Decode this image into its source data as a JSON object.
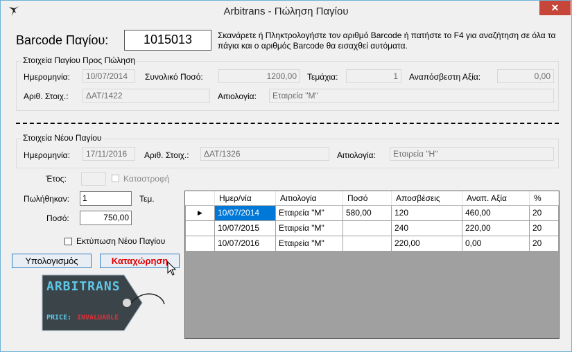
{
  "window": {
    "title": "Arbitrans - Πώληση Παγίου",
    "close_glyph": "✕"
  },
  "barcode": {
    "label": "Barcode Παγίου:",
    "value": "1015013",
    "hint": "Σκανάρετε ή Πληκτρολογήστε τον αριθμό Barcode ή πατήστε το F4 για αναζήτηση σε όλα τα πάγια και ο αριθμός Barcode θα εισαχθεί αυτόματα."
  },
  "sale_group": {
    "title": "Στοιχεία Παγίου Προς Πώληση",
    "date_label": "Ημερομηνία:",
    "date_value": "10/07/2014",
    "total_label": "Συνολικό Ποσό:",
    "total_value": "1200,00",
    "pieces_label": "Τεμάχια:",
    "pieces_value": "1",
    "residual_label": "Αναπόσβεστη Αξία:",
    "residual_value": "0,00",
    "doc_label": "Αριθ. Στοιχ.:",
    "doc_value": "ΔΑΤ/1422",
    "reason_label": "Αιτιολογία:",
    "reason_value": "Εταιρεία \"Μ\""
  },
  "new_group": {
    "title": "Στοιχεία Νέου Παγίου",
    "date_label": "Ημερομηνία:",
    "date_value": "17/11/2016",
    "doc_label": "Αριθ. Στοιχ.:",
    "doc_value": "ΔΑΤ/1326",
    "reason_label": "Αιτιολογία:",
    "reason_value": "Εταιρεία \"Η\""
  },
  "form": {
    "year_label": "Έτος:",
    "year_value": "",
    "destroy_label": "Καταστροφή",
    "sold_label": "Πωλήθηκαν:",
    "sold_value": "1",
    "sold_unit": "Τεμ.",
    "amount_label": "Ποσό:",
    "amount_value": "750,00",
    "print_label": "Εκτύπωση Νέου Παγίου"
  },
  "buttons": {
    "calculate": "Υπολογισμός",
    "register": "Καταχώρηση"
  },
  "logo": {
    "brand": "ARBITRANS",
    "price_label": "PRICE:",
    "price_value": "INVALUABLE"
  },
  "grid": {
    "columns": [
      "Ημερ/νία",
      "Αιτιολογία",
      "Ποσό",
      "Αποσβέσεις",
      "Αναπ. Αξία",
      "%"
    ],
    "current_row_marker": "▶",
    "rows": [
      [
        "10/07/2014",
        "Εταιρεία \"Μ\"",
        "580,00",
        "120",
        "460,00",
        "20"
      ],
      [
        "10/07/2015",
        "Εταιρεία \"Μ\"",
        "",
        "240",
        "220,00",
        "20"
      ],
      [
        "10/07/2016",
        "Εταιρεία \"Μ\"",
        "",
        "220,00",
        "0,00",
        "20"
      ]
    ]
  },
  "colors": {
    "accent": "#0078d7",
    "register_text": "#e00000",
    "close_bg": "#c7463a"
  }
}
